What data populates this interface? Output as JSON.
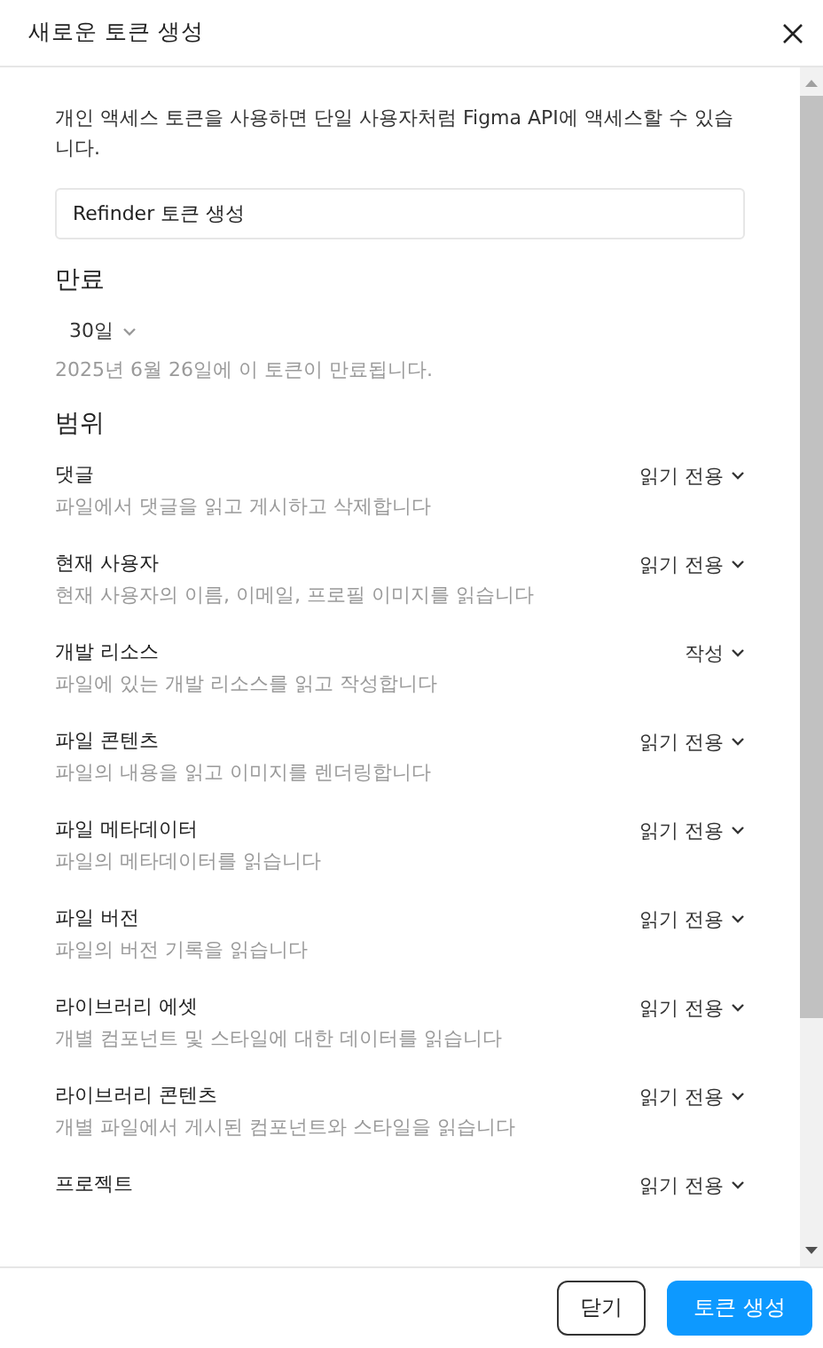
{
  "dialog": {
    "title": "새로운 토큰 생성"
  },
  "intro": "개인 액세스 토큰을 사용하면 단일 사용자처럼 Figma API에 액세스할 수 있습니다.",
  "token_name": {
    "value": "Refinder 토큰 생성"
  },
  "expiration": {
    "heading": "만료",
    "value": "30일",
    "note": "2025년 6월 26일에 이 토큰이 만료됩니다."
  },
  "scopes": {
    "heading": "범위",
    "items": [
      {
        "title": "댓글",
        "description": "파일에서 댓글을 읽고 게시하고 삭제합니다",
        "access": "읽기 전용"
      },
      {
        "title": "현재 사용자",
        "description": "현재 사용자의 이름, 이메일, 프로필 이미지를 읽습니다",
        "access": "읽기 전용"
      },
      {
        "title": "개발 리소스",
        "description": "파일에 있는 개발 리소스를 읽고 작성합니다",
        "access": "작성"
      },
      {
        "title": "파일 콘텐츠",
        "description": "파일의 내용을 읽고 이미지를 렌더링합니다",
        "access": "읽기 전용"
      },
      {
        "title": "파일 메타데이터",
        "description": "파일의 메타데이터를 읽습니다",
        "access": "읽기 전용"
      },
      {
        "title": "파일 버전",
        "description": "파일의 버전 기록을 읽습니다",
        "access": "읽기 전용"
      },
      {
        "title": "라이브러리 에셋",
        "description": "개별 컴포넌트 및 스타일에 대한 데이터를 읽습니다",
        "access": "읽기 전용"
      },
      {
        "title": "라이브러리 콘텐츠",
        "description": "개별 파일에서 게시된 컴포넌트와 스타일을 읽습니다",
        "access": "읽기 전용"
      },
      {
        "title": "프로젝트",
        "access": "읽기 전용"
      }
    ]
  },
  "buttons": [
    {
      "label": "닫기",
      "kind": "secondary"
    },
    {
      "label": "토큰 생성",
      "kind": "primary"
    }
  ]
}
